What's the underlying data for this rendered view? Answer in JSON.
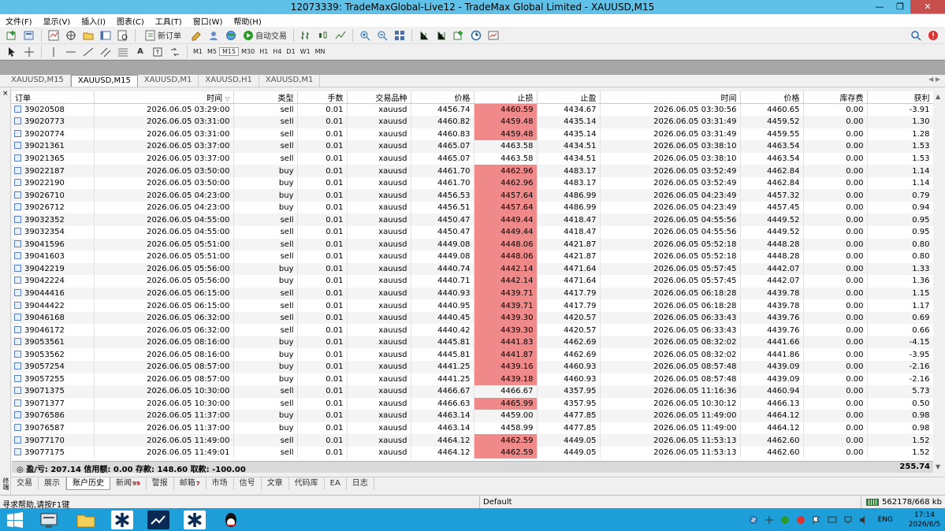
{
  "window": {
    "title": "12073339: TradeMaxGlobal-Live12 - TradeMax Global Limited - XAUUSD,M15",
    "minimize": "—",
    "restore": "❐",
    "close": "✕"
  },
  "menu": [
    "文件(F)",
    "显示(V)",
    "插入(I)",
    "图表(C)",
    "工具(T)",
    "窗口(W)",
    "帮助(H)"
  ],
  "toolbar": {
    "new_order": "新订单",
    "auto_trading": "自动交易"
  },
  "timeframes": [
    "M1",
    "M5",
    "M15",
    "M30",
    "H1",
    "H4",
    "D1",
    "W1",
    "MN"
  ],
  "chart_tabs": [
    "XAUUSD,M15",
    "XAUUSD,M15",
    "XAUUSD,M1",
    "XAUUSD,H1",
    "XAUUSD,M1"
  ],
  "active_chart_tab": 1,
  "table": {
    "headers": [
      "订单",
      "时间",
      "类型",
      "手数",
      "交易品种",
      "价格",
      "止损",
      "止盈",
      "时间",
      "价格",
      "库存费",
      "获利"
    ],
    "sort_indicator": "▽",
    "rows": [
      [
        "39020508",
        "2026.06.05 03:29:00",
        "sell",
        "0.01",
        "xauusd",
        "4456.74",
        "4460.59",
        "4434.67",
        "2026.06.05 03:30:56",
        "4460.65",
        "0.00",
        "-3.91",
        true
      ],
      [
        "39020773",
        "2026.06.05 03:31:00",
        "sell",
        "0.01",
        "xauusd",
        "4460.82",
        "4459.48",
        "4435.14",
        "2026.06.05 03:31:49",
        "4459.52",
        "0.00",
        "1.30",
        true
      ],
      [
        "39020774",
        "2026.06.05 03:31:00",
        "sell",
        "0.01",
        "xauusd",
        "4460.83",
        "4459.48",
        "4435.14",
        "2026.06.05 03:31:49",
        "4459.55",
        "0.00",
        "1.28",
        true
      ],
      [
        "39021361",
        "2026.06.05 03:37:00",
        "sell",
        "0.01",
        "xauusd",
        "4465.07",
        "4463.58",
        "4434.51",
        "2026.06.05 03:38:10",
        "4463.54",
        "0.00",
        "1.53",
        false
      ],
      [
        "39021365",
        "2026.06.05 03:37:00",
        "sell",
        "0.01",
        "xauusd",
        "4465.07",
        "4463.58",
        "4434.51",
        "2026.06.05 03:38:10",
        "4463.54",
        "0.00",
        "1.53",
        false
      ],
      [
        "39022187",
        "2026.06.05 03:50:00",
        "buy",
        "0.01",
        "xauusd",
        "4461.70",
        "4462.96",
        "4483.17",
        "2026.06.05 03:52:49",
        "4462.84",
        "0.00",
        "1.14",
        true
      ],
      [
        "39022190",
        "2026.06.05 03:50:00",
        "buy",
        "0.01",
        "xauusd",
        "4461.70",
        "4462.96",
        "4483.17",
        "2026.06.05 03:52:49",
        "4462.84",
        "0.00",
        "1.14",
        true
      ],
      [
        "39026710",
        "2026.06.05 04:23:00",
        "buy",
        "0.01",
        "xauusd",
        "4456.53",
        "4457.64",
        "4486.99",
        "2026.06.05 04:23:49",
        "4457.32",
        "0.00",
        "0.79",
        true
      ],
      [
        "39026712",
        "2026.06.05 04:23:00",
        "buy",
        "0.01",
        "xauusd",
        "4456.51",
        "4457.64",
        "4486.99",
        "2026.06.05 04:23:49",
        "4457.45",
        "0.00",
        "0.94",
        true
      ],
      [
        "39032352",
        "2026.06.05 04:55:00",
        "sell",
        "0.01",
        "xauusd",
        "4450.47",
        "4449.44",
        "4418.47",
        "2026.06.05 04:55:56",
        "4449.52",
        "0.00",
        "0.95",
        true
      ],
      [
        "39032354",
        "2026.06.05 04:55:00",
        "sell",
        "0.01",
        "xauusd",
        "4450.47",
        "4449.44",
        "4418.47",
        "2026.06.05 04:55:56",
        "4449.52",
        "0.00",
        "0.95",
        true
      ],
      [
        "39041596",
        "2026.06.05 05:51:00",
        "sell",
        "0.01",
        "xauusd",
        "4449.08",
        "4448.06",
        "4421.87",
        "2026.06.05 05:52:18",
        "4448.28",
        "0.00",
        "0.80",
        true
      ],
      [
        "39041603",
        "2026.06.05 05:51:00",
        "sell",
        "0.01",
        "xauusd",
        "4449.08",
        "4448.06",
        "4421.87",
        "2026.06.05 05:52:18",
        "4448.28",
        "0.00",
        "0.80",
        true
      ],
      [
        "39042219",
        "2026.06.05 05:56:00",
        "buy",
        "0.01",
        "xauusd",
        "4440.74",
        "4442.14",
        "4471.64",
        "2026.06.05 05:57:45",
        "4442.07",
        "0.00",
        "1.33",
        true
      ],
      [
        "39042224",
        "2026.06.05 05:56:00",
        "buy",
        "0.01",
        "xauusd",
        "4440.71",
        "4442.14",
        "4471.64",
        "2026.06.05 05:57:45",
        "4442.07",
        "0.00",
        "1.36",
        true
      ],
      [
        "39044416",
        "2026.06.05 06:15:00",
        "sell",
        "0.01",
        "xauusd",
        "4440.93",
        "4439.71",
        "4417.79",
        "2026.06.05 06:18:28",
        "4439.78",
        "0.00",
        "1.15",
        true
      ],
      [
        "39044422",
        "2026.06.05 06:15:00",
        "sell",
        "0.01",
        "xauusd",
        "4440.95",
        "4439.71",
        "4417.79",
        "2026.06.05 06:18:28",
        "4439.78",
        "0.00",
        "1.17",
        true
      ],
      [
        "39046168",
        "2026.06.05 06:32:00",
        "sell",
        "0.01",
        "xauusd",
        "4440.45",
        "4439.30",
        "4420.57",
        "2026.06.05 06:33:43",
        "4439.76",
        "0.00",
        "0.69",
        true
      ],
      [
        "39046172",
        "2026.06.05 06:32:00",
        "sell",
        "0.01",
        "xauusd",
        "4440.42",
        "4439.30",
        "4420.57",
        "2026.06.05 06:33:43",
        "4439.76",
        "0.00",
        "0.66",
        true
      ],
      [
        "39053561",
        "2026.06.05 08:16:00",
        "buy",
        "0.01",
        "xauusd",
        "4445.81",
        "4441.83",
        "4462.69",
        "2026.06.05 08:32:02",
        "4441.66",
        "0.00",
        "-4.15",
        true
      ],
      [
        "39053562",
        "2026.06.05 08:16:00",
        "buy",
        "0.01",
        "xauusd",
        "4445.81",
        "4441.87",
        "4462.69",
        "2026.06.05 08:32:02",
        "4441.86",
        "0.00",
        "-3.95",
        true
      ],
      [
        "39057254",
        "2026.06.05 08:57:00",
        "buy",
        "0.01",
        "xauusd",
        "4441.25",
        "4439.16",
        "4460.93",
        "2026.06.05 08:57:48",
        "4439.09",
        "0.00",
        "-2.16",
        true
      ],
      [
        "39057255",
        "2026.06.05 08:57:00",
        "buy",
        "0.01",
        "xauusd",
        "4441.25",
        "4439.18",
        "4460.93",
        "2026.06.05 08:57:48",
        "4439.09",
        "0.00",
        "-2.16",
        true
      ],
      [
        "39071375",
        "2026.06.05 10:30:00",
        "sell",
        "0.01",
        "xauusd",
        "4466.67",
        "4466.67",
        "4357.95",
        "2026.06.05 11:16:36",
        "4460.94",
        "0.00",
        "5.73",
        false
      ],
      [
        "39071377",
        "2026.06.05 10:30:00",
        "sell",
        "0.01",
        "xauusd",
        "4466.63",
        "4465.99",
        "4357.95",
        "2026.06.05 10:30:12",
        "4466.13",
        "0.00",
        "0.50",
        true
      ],
      [
        "39076586",
        "2026.06.05 11:37:00",
        "buy",
        "0.01",
        "xauusd",
        "4463.14",
        "4459.00",
        "4477.85",
        "2026.06.05 11:49:00",
        "4464.12",
        "0.00",
        "0.98",
        false
      ],
      [
        "39076587",
        "2026.06.05 11:37:00",
        "buy",
        "0.01",
        "xauusd",
        "4463.14",
        "4458.99",
        "4477.85",
        "2026.06.05 11:49:00",
        "4464.12",
        "0.00",
        "0.98",
        false
      ],
      [
        "39077170",
        "2026.06.05 11:49:00",
        "sell",
        "0.01",
        "xauusd",
        "4464.12",
        "4462.59",
        "4449.05",
        "2026.06.05 11:53:13",
        "4462.60",
        "0.00",
        "1.52",
        true
      ],
      [
        "39077175",
        "2026.06.05 11:49:01",
        "sell",
        "0.01",
        "xauusd",
        "4464.12",
        "4462.59",
        "4449.05",
        "2026.06.05 11:53:13",
        "4462.60",
        "0.00",
        "1.52",
        true
      ]
    ]
  },
  "summary": {
    "text": "盈/亏: 207.14  信用额: 0.00  存款: 148.60  取款: -100.00",
    "total": "255.74"
  },
  "terminal_tabs": [
    {
      "label": "交易"
    },
    {
      "label": "展示"
    },
    {
      "label": "账户历史"
    },
    {
      "label": "新闻",
      "badge": "99"
    },
    {
      "label": "警报"
    },
    {
      "label": "邮箱",
      "badge": "7"
    },
    {
      "label": "市场"
    },
    {
      "label": "信号"
    },
    {
      "label": "文章"
    },
    {
      "label": "代码库"
    },
    {
      "label": "EA"
    },
    {
      "label": "日志"
    }
  ],
  "active_terminal_tab": 2,
  "side_panel": {
    "label": "终端"
  },
  "statusbar": {
    "help": "寻求帮助,请按F1键",
    "profile": "Default",
    "traffic": "562178/668 kb"
  },
  "taskbar": {
    "lang": "ENG",
    "time": "17:14",
    "date": "2026/6/5"
  },
  "colors": {
    "titlebar": "#5fc1e8",
    "stoploss_highlight": "#f08a8a",
    "taskbar": "#1f9fd9",
    "close_button": "#c7504f"
  }
}
